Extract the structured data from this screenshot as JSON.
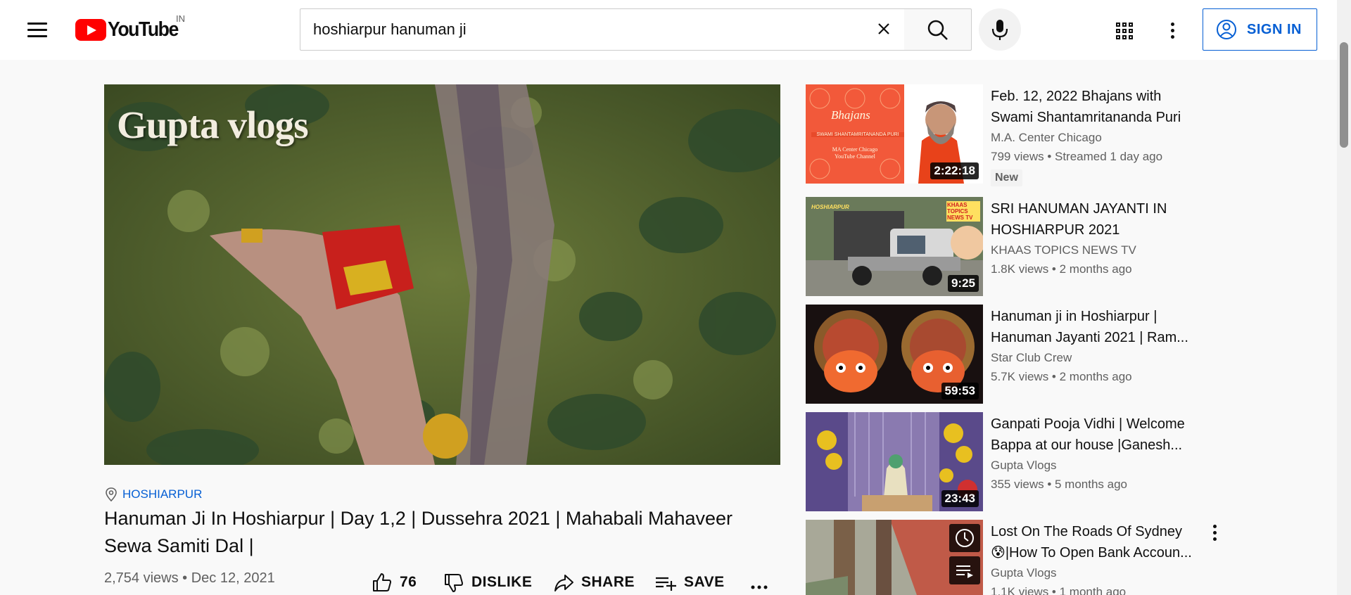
{
  "header": {
    "logo_text": "YouTube",
    "country_code": "IN",
    "search_value": "hoshiarpur hanuman ji",
    "signin_label": "SIGN IN"
  },
  "video": {
    "watermark": "Gupta vlogs",
    "location": "HOSHIARPUR",
    "title": "Hanuman Ji In Hoshiarpur | Day 1,2 | Dussehra 2021 | Mahabali Mahaveer Sewa Samiti Dal |",
    "stats": "2,754 views • Dec 12, 2021",
    "like_count": "76",
    "dislike_label": "DISLIKE",
    "share_label": "SHARE",
    "save_label": "SAVE"
  },
  "recommendations": [
    {
      "title": "Feb. 12, 2022 Bhajans with Swami Shantamritananda Puri",
      "channel": "M.A. Center Chicago",
      "meta": "799 views • Streamed 1 day ago",
      "badge": "New",
      "duration": "2:22:18",
      "thumb_text": "Bhajans",
      "thumb_sub": "SWAMI SHANTAMRITANANDA PURI",
      "thumb_sub2": "MA Center Chicago",
      "thumb_sub3": "YouTube Channel"
    },
    {
      "title": "SRI HANUMAN JAYANTI IN HOSHIARPUR 2021",
      "channel": "KHAAS TOPICS NEWS TV",
      "meta": "1.8K views • 2 months ago",
      "duration": "9:25",
      "thumb_text": "HOSHIARPUR",
      "thumb_badge": "KHAAS TOPICS NEWS TV"
    },
    {
      "title": "Hanuman ji in Hoshiarpur | Hanuman Jayanti 2021 | Ram...",
      "channel": "Star Club Crew",
      "meta": "5.7K views • 2 months ago",
      "duration": "59:53"
    },
    {
      "title": "Ganpati Pooja Vidhi | Welcome Bappa at our house |Ganesh...",
      "channel": "Gupta Vlogs",
      "meta": "355 views • 5 months ago",
      "duration": "23:43"
    },
    {
      "title": "Lost On The Roads Of Sydney 😰|How To Open Bank Accoun...",
      "channel": "Gupta Vlogs",
      "meta": "1.1K views • 1 month ago"
    }
  ],
  "icons": {
    "menu": "menu-icon",
    "search": "search-icon",
    "clear": "close-icon",
    "mic": "mic-icon",
    "apps": "apps-icon",
    "more": "more-vert-icon",
    "account": "account-icon",
    "location": "location-pin-icon",
    "like": "thumbs-up-icon",
    "dislike": "thumbs-down-icon",
    "share": "share-icon",
    "save": "playlist-add-icon",
    "watch_later": "clock-icon",
    "add_queue": "queue-icon"
  },
  "colors": {
    "brand_red": "#ff0000",
    "link_blue": "#065fd4",
    "text_primary": "#0f0f0f",
    "text_secondary": "#606060",
    "page_bg": "#f9f9f9"
  }
}
